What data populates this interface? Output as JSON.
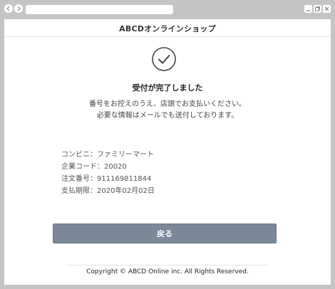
{
  "header": {
    "title": "ABCDオンラインショップ"
  },
  "status": {
    "title": "受付が完了しました",
    "lines": [
      "番号をお控えのうえ、店頭でお支払いください。",
      "必要な情報はメールでも送付しております。"
    ]
  },
  "payment_info": [
    "コンビニ：ファミリーマート",
    "企業コード：20020",
    "注文番号：911169811844",
    "支払期限：2020年02月02日"
  ],
  "actions": {
    "back_label": "戻る"
  },
  "footer": {
    "copyright": "Copyright © ABCD Online inc. All Rights Reserved."
  },
  "colors": {
    "chrome": "#c4c4c4",
    "button": "#7a8898",
    "text": "#333333"
  },
  "icons": [
    "back-arrow-icon",
    "forward-arrow-icon",
    "minimize-icon",
    "restore-icon",
    "close-icon",
    "check-circle-icon"
  ]
}
